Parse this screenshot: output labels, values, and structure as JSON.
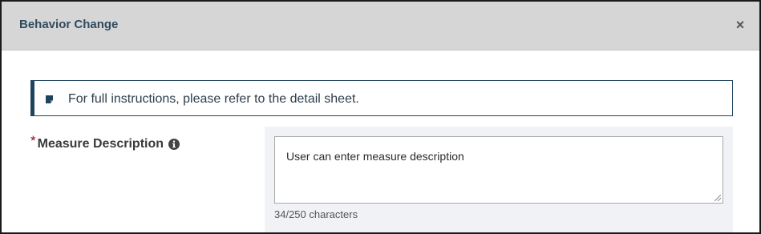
{
  "dialog": {
    "title": "Behavior Change",
    "close_label": "×"
  },
  "banner": {
    "text": "For full instructions, please refer to the detail sheet.",
    "icon": "note-icon"
  },
  "measure_description": {
    "required_marker": "*",
    "label": "Measure Description",
    "info_icon": "info-circle-icon",
    "value": "User can enter measure description",
    "char_count": "34/250 characters"
  },
  "colors": {
    "header_bg": "#d6d6d6",
    "title": "#2f4b60",
    "banner_border": "#1f4460",
    "required": "#8b0a1a",
    "panel_bg": "#f1f2f5"
  }
}
